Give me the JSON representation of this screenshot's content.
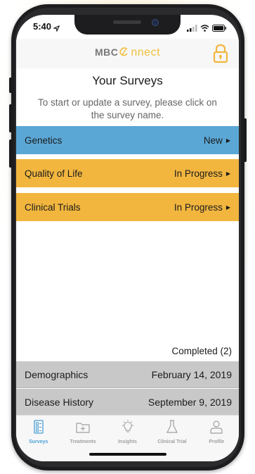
{
  "status_bar": {
    "time": "5:40"
  },
  "header": {
    "logo_prefix": "MBC",
    "logo_suffix": "nnect"
  },
  "page": {
    "title": "Your Surveys",
    "subtitle": "To start or update a survey, please click on the survey name."
  },
  "surveys": [
    {
      "name": "Genetics",
      "status": "New",
      "color": "#5aa7d6"
    },
    {
      "name": "Quality of Life",
      "status": "In Progress",
      "color": "#f2b63f"
    },
    {
      "name": "Clinical Trials",
      "status": "In Progress",
      "color": "#f2b63f"
    }
  ],
  "completed": {
    "label": "Completed (2)",
    "items": [
      {
        "name": "Demographics",
        "date": "February 14, 2019"
      },
      {
        "name": "Disease History",
        "date": "September 9, 2019"
      }
    ]
  },
  "tabs": [
    {
      "label": "Surveys",
      "icon": "survey-clipboard-icon",
      "active": true
    },
    {
      "label": "Treatments",
      "icon": "treatments-folder-icon",
      "active": false
    },
    {
      "label": "Insights",
      "icon": "lightbulb-icon",
      "active": false
    },
    {
      "label": "Clinical Trial",
      "icon": "flask-icon",
      "active": false
    },
    {
      "label": "Profile",
      "icon": "person-icon",
      "active": false
    }
  ],
  "colors": {
    "accent_blue": "#5aa7d6",
    "accent_yellow": "#f2b63f",
    "tab_active": "#4a9fd4"
  }
}
